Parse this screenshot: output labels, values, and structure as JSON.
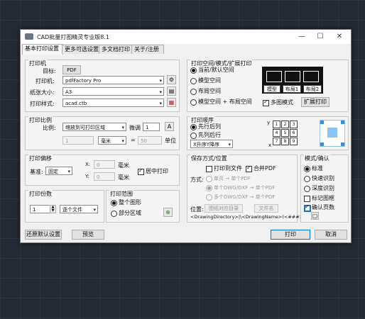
{
  "window": {
    "title": "CAD批量打图精灵专业版8.1",
    "minimize_symbol": "—",
    "maximize_symbol": "☐",
    "close_symbol": "✕"
  },
  "tabs": [
    "基本打印设置",
    "更多可选设置",
    "多文档打印",
    "关于/注册"
  ],
  "printer": {
    "group_title": "打印机",
    "target_label": "目标:",
    "target_value": "PDF",
    "printer_label": "打印机:",
    "printer_value": "pdfFactory Pro",
    "paper_label": "纸张大小:",
    "paper_value": "A3",
    "style_label": "打印样式:",
    "style_value": "acad.ctb"
  },
  "scale": {
    "group_title": "打印比例",
    "ratio_label": "比例:",
    "ratio_value": "缩放到可打印区域",
    "fine_label": "微调",
    "fine_value": "1",
    "left_value": "1",
    "unit_select": "毫米",
    "eq": "=",
    "right_value": "50",
    "unit_label": "单位"
  },
  "offset": {
    "group_title": "打印偏移",
    "base_label": "基准:",
    "base_value": "固定",
    "x_label": "X:",
    "x_value": "0",
    "y_label": "Y:",
    "y_value": "0",
    "x_unit": "毫米",
    "y_unit": "毫米",
    "center_label": "居中打印"
  },
  "copies": {
    "group_title": "打印份数",
    "count": "1",
    "mode": "逐个文件"
  },
  "range": {
    "group_title": "打印范围",
    "whole": "整个图形",
    "partial": "部分区域"
  },
  "space": {
    "group_title": "打印空间/模式/扩展打印",
    "options": [
      "当前/默认空间",
      "模型空间",
      "布局空间",
      "模型空间 + 布局空间"
    ],
    "multi_label": "多图模式",
    "expand_button": "扩展打印",
    "preview_tabs": [
      "模型",
      "布局1",
      "布局2"
    ]
  },
  "order": {
    "group_title": "打印顺序",
    "options": [
      "先行后列",
      "先列后行"
    ],
    "sort_value": "X升序Y降序",
    "grid_nums": [
      "1",
      "2",
      "3",
      "4",
      "5",
      "6",
      "7",
      "8",
      "9"
    ],
    "axis_y": "y",
    "axis_x": "x"
  },
  "save": {
    "group_title": "保存方式/位置",
    "print_to_file": "打印到文件",
    "merge_pdf": "合并PDF",
    "method_label": "方式:",
    "methods": [
      "单页 → 单个PDF",
      "单个DWG/DXF → 单个PDF",
      "多个DWG/DXF → 单个PDF"
    ],
    "location_label": "位置:",
    "location_button": "图纸对应目录",
    "filename_button": "文件名",
    "path_text": "<DrawingDirectory>|\\<DrawingName>(<###>"
  },
  "mode": {
    "group_title": "模式/确认",
    "options": [
      "标准",
      "快速识别",
      "深度识别"
    ],
    "mark_label": "标记图框",
    "confirm_label": "确认页数"
  },
  "footer": {
    "restore": "还原默认设置",
    "preview": "预览",
    "print": "打印",
    "cancel": "取消"
  },
  "colors": {
    "accent": "#0078d7",
    "check_blue": "#1a6fd1",
    "preview_highlight": "#2e8fe6",
    "canvas": "#242a33"
  }
}
